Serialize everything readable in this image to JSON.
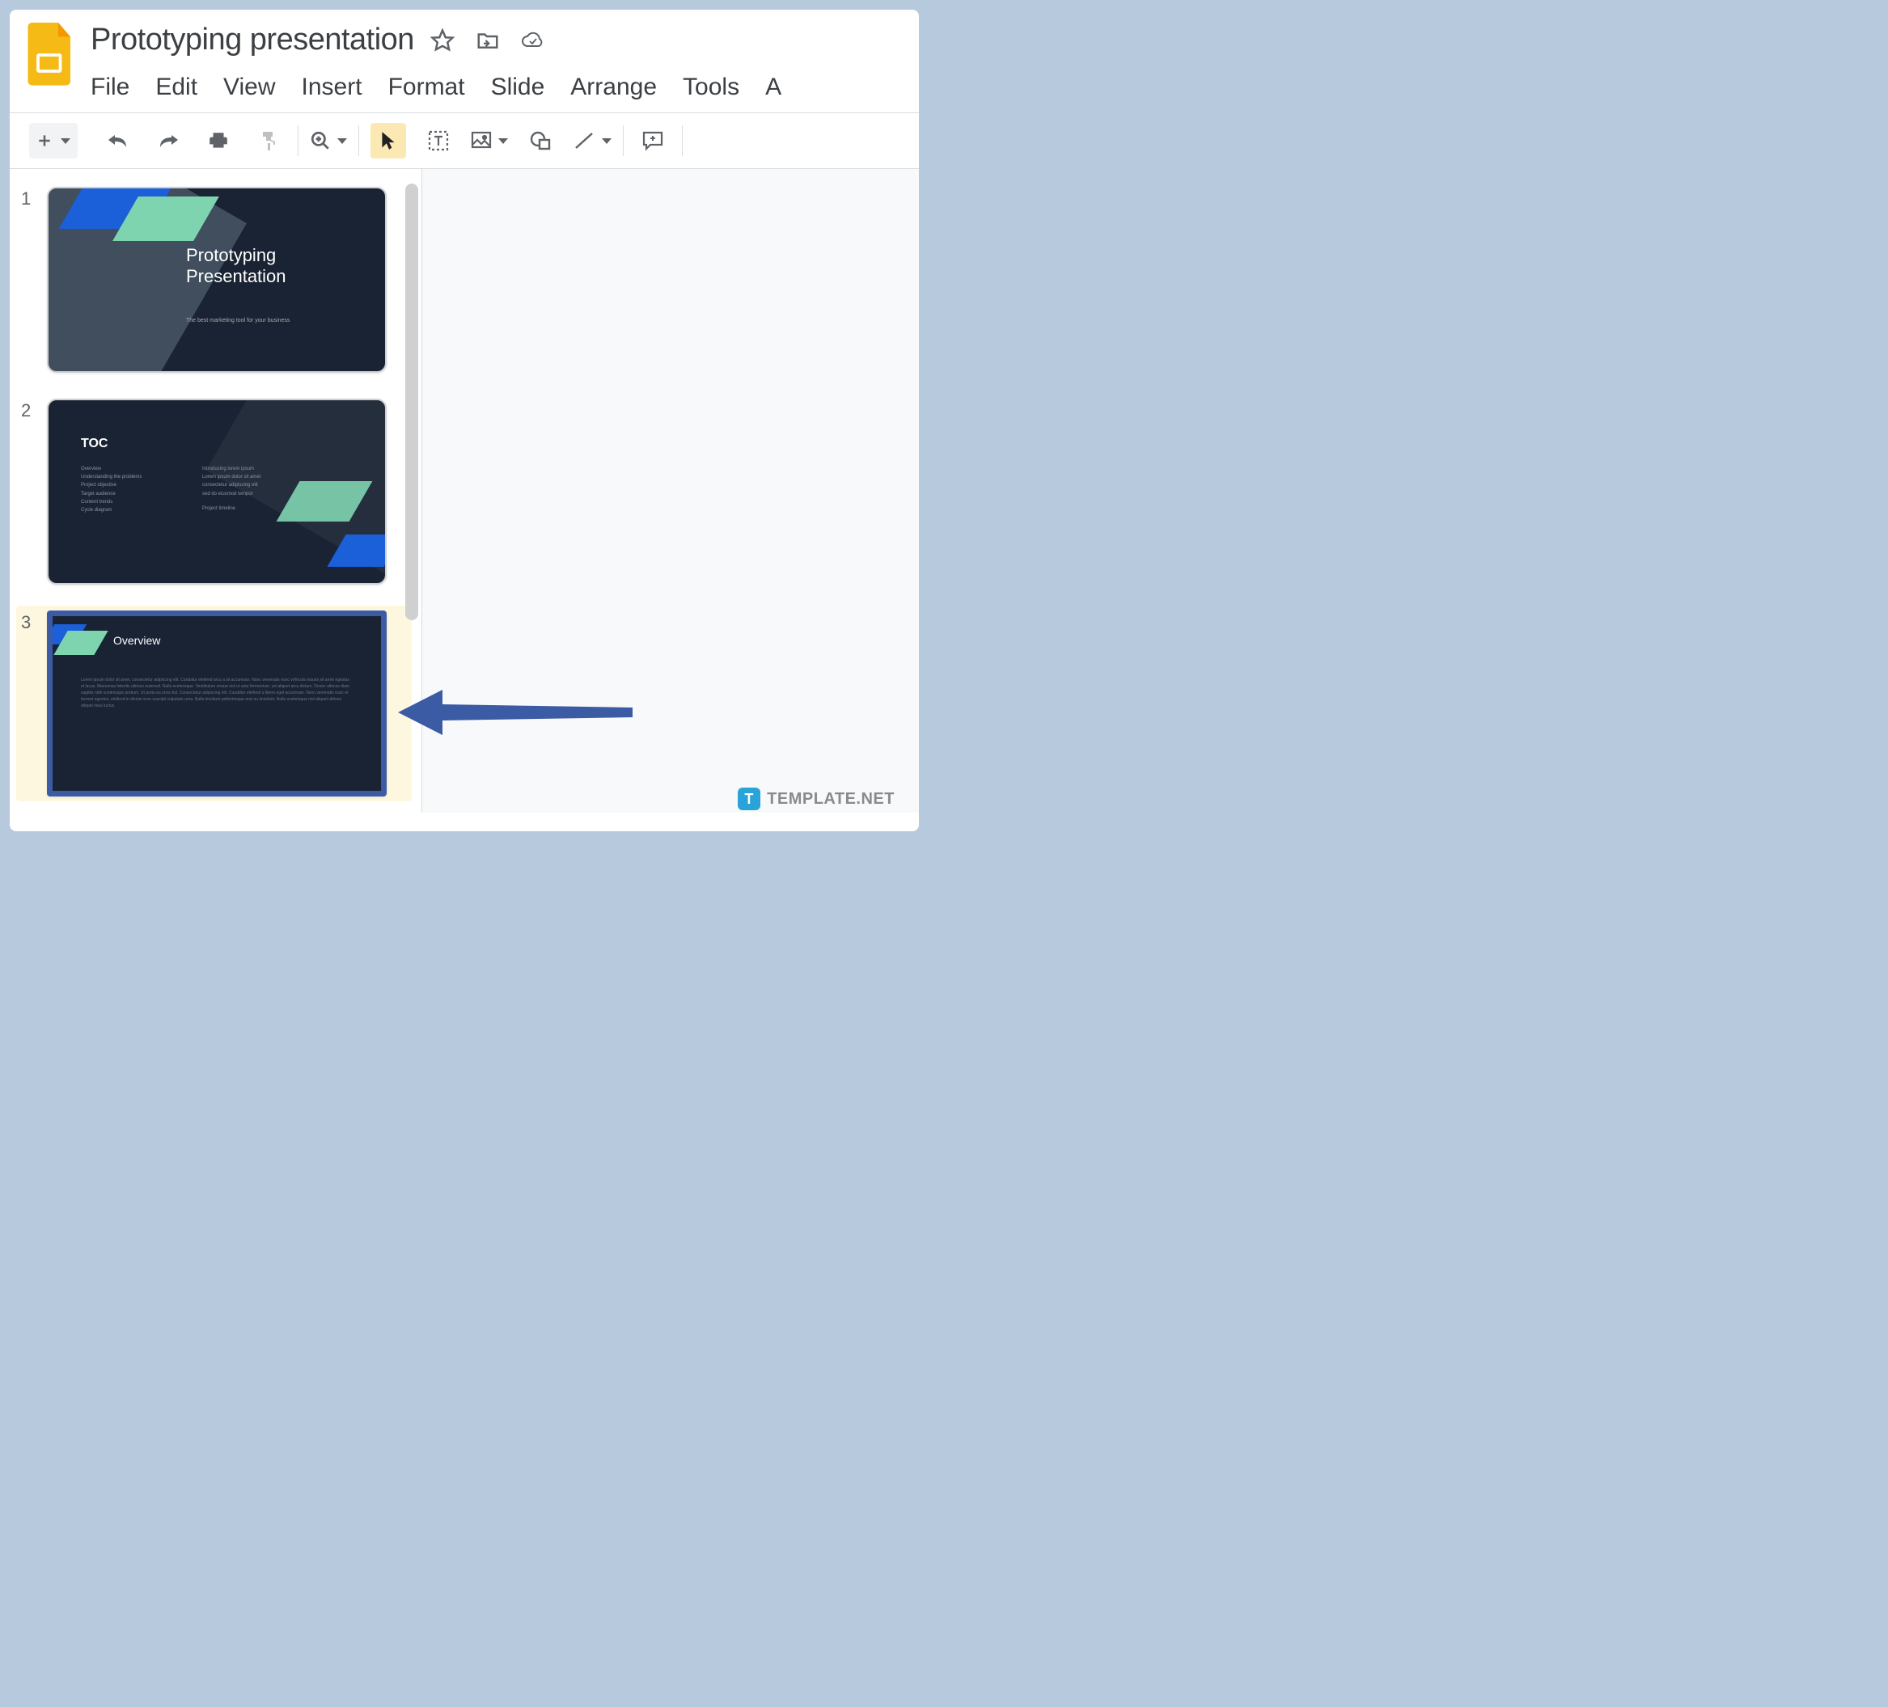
{
  "doc": {
    "title": "Prototyping presentation"
  },
  "menu": {
    "file": "File",
    "edit": "Edit",
    "view": "View",
    "insert": "Insert",
    "format": "Format",
    "slide": "Slide",
    "arrange": "Arrange",
    "tools": "Tools",
    "addons_partial": "A"
  },
  "filmstrip": {
    "slides": [
      {
        "num": "1",
        "title_l1": "Prototyping",
        "title_l2": "Presentation",
        "sub": "The best marketing tool for your business"
      },
      {
        "num": "2",
        "title": "TOC",
        "col1": [
          "Overview",
          "Understanding the problems",
          "Project objective",
          "Target audience",
          "Content trends",
          "Cycle diagram"
        ],
        "col2": [
          "Introducing lorem ipsum",
          "Lorem ipsum dolor sit amet",
          "consectetur adipiscing elit",
          "sed do eiusmod tempor",
          "Project timeline"
        ]
      },
      {
        "num": "3",
        "title": "Overview",
        "body": "Lorem ipsum dolor sit amet, consectetur adipiscing elit. Curabitur eleifend arcu a sit accumsan. Nunc venenatis nunc vehicula mauris sit amet egestas et lacus. Maecenas lobortis ultrices euismod. Nulla scelerisque.\n\nVestibulum ornare nisl ut ante fermentum, vel aliquet arcu dictum. Donec ultrices diam sagittis nibh scelerisque pretium. Ut porta eu urna nisl. Consectetur adipiscing elit. Curabitur eleifend a libero eget accumsan. Nunc venenatis nunc et laoreet egestas, eleifend in dictum eros suscipit vulputate urna. Nulla tincidunt pellentesque erat eu tincidunt. Nulla scelerisque nisl aliquet ultrices aliquet risus luctus."
      }
    ],
    "selected_index": 2
  },
  "watermark": {
    "icon": "T",
    "text": "TEMPLATE.NET"
  }
}
